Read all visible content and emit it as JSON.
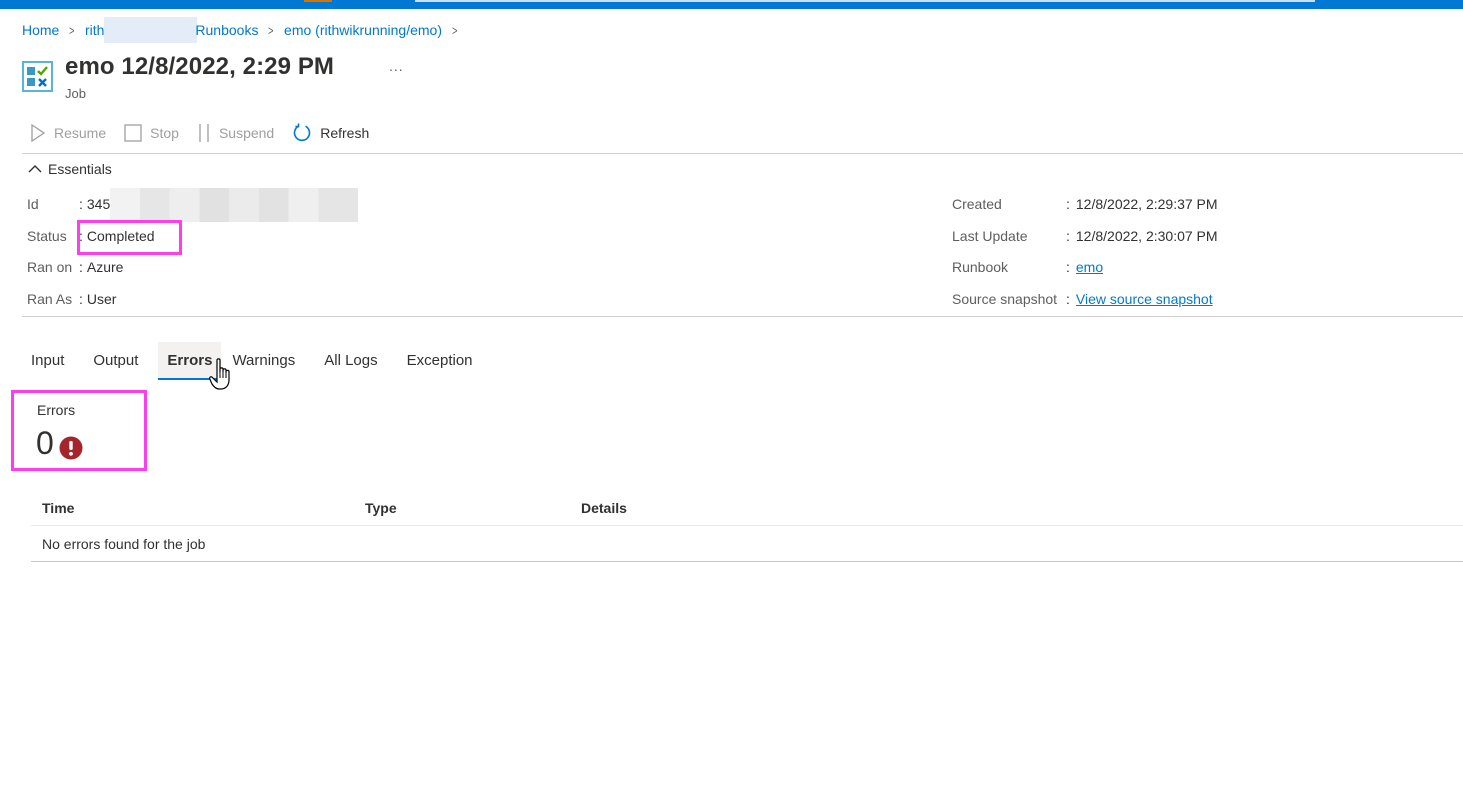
{
  "topbar": {
    "accent": "#0078d4"
  },
  "breadcrumb": {
    "items": [
      {
        "label": "Home"
      },
      {
        "label": "rith"
      },
      {
        "label": "Runbooks"
      },
      {
        "label": "emo (rithwikrunning/emo)"
      }
    ]
  },
  "header": {
    "title": "emo 12/8/2022, 2:29 PM",
    "subtitle": "Job",
    "icon": "job-checklist-icon",
    "more_label": "..."
  },
  "toolbar": {
    "resume_label": "Resume",
    "stop_label": "Stop",
    "suspend_label": "Suspend",
    "refresh_label": "Refresh"
  },
  "essentials": {
    "toggle_label": "Essentials",
    "left": [
      {
        "label": "Id",
        "value": "345"
      },
      {
        "label": "Status",
        "value": "Completed"
      },
      {
        "label": "Ran on",
        "value": "Azure"
      },
      {
        "label": "Ran As",
        "value": "User"
      }
    ],
    "right": [
      {
        "label": "Created",
        "value": "12/8/2022, 2:29:37 PM"
      },
      {
        "label": "Last Update",
        "value": "12/8/2022, 2:30:07 PM"
      },
      {
        "label": "Runbook",
        "value": "emo"
      },
      {
        "label": "Source snapshot",
        "value": "View source snapshot"
      }
    ],
    "separator": ":"
  },
  "tabs": {
    "items": [
      {
        "label": "Input"
      },
      {
        "label": "Output"
      },
      {
        "label": "Errors"
      },
      {
        "label": "Warnings"
      },
      {
        "label": "All Logs"
      },
      {
        "label": "Exception"
      }
    ],
    "active": "Errors"
  },
  "errors_summary": {
    "label": "Errors",
    "count": "0",
    "icon_color": "#a4262c"
  },
  "errors_table": {
    "columns": [
      "Time",
      "Type",
      "Details"
    ],
    "empty_message": "No errors found for the job"
  },
  "highlight_color": "#ff3cf0"
}
